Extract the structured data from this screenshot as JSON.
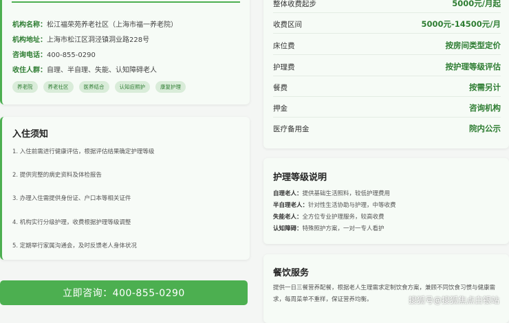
{
  "info": {
    "name_key": "机构名称：",
    "name_val": "松江福荣苑养老社区（上海市福一养老院）",
    "addr_key": "机构地址：",
    "addr_val": "上海市松江区洞泾镇洞业路228号",
    "phone_key": "咨询电话：",
    "phone_val": "400-855-0290",
    "crowd_key": "收住人群：",
    "crowd_val": "自理、半自理、失能、认知障碍老人",
    "tags": [
      "养老院",
      "养老社区",
      "医养结合",
      "认知症照护",
      "康复护理"
    ]
  },
  "notice": {
    "title": "入住须知",
    "items": [
      "1. 入住前需进行健康评估，根据评估结果确定护理等级",
      "2. 提供完整的病史资料及体检报告",
      "3. 办理入住需提供身份证、户口本等相关证件",
      "4. 机构实行分级护理，收费根据护理等级调整",
      "5. 定期举行家属沟通会，及时反馈老人身体状况"
    ]
  },
  "consult_button": "立即咨询：400-855-0290",
  "fees": [
    {
      "label": "整体收费起步",
      "value": "5000元/月起"
    },
    {
      "label": "收费区间",
      "value": "5000元-14500元/月"
    },
    {
      "label": "床位费",
      "value": "按房间类型定价"
    },
    {
      "label": "护理费",
      "value": "按护理等级评估"
    },
    {
      "label": "餐费",
      "value": "按需另计"
    },
    {
      "label": "押金",
      "value": "咨询机构"
    },
    {
      "label": "医疗备用金",
      "value": "院内公示"
    }
  ],
  "level": {
    "title": "护理等级说明",
    "items": [
      {
        "k": "自理老人：",
        "v": "提供基础生活照料，较低护理费用"
      },
      {
        "k": "半自理老人：",
        "v": "针对性生活协助与护理，中等收费"
      },
      {
        "k": "失能老人：",
        "v": "全方位专业护理服务，较高收费"
      },
      {
        "k": "认知障碍：",
        "v": "特殊照护方案，一对一专人看护"
      }
    ]
  },
  "food": {
    "title": "餐饮服务",
    "text": "提供一日三餐营养配餐，根据老人生理需求定制饮食方案，兼顾不同饮食习惯与健康需求，每周菜单不重样，保证营养均衡。"
  },
  "watermark": "搜狐号@搜狐焦点白银站"
}
